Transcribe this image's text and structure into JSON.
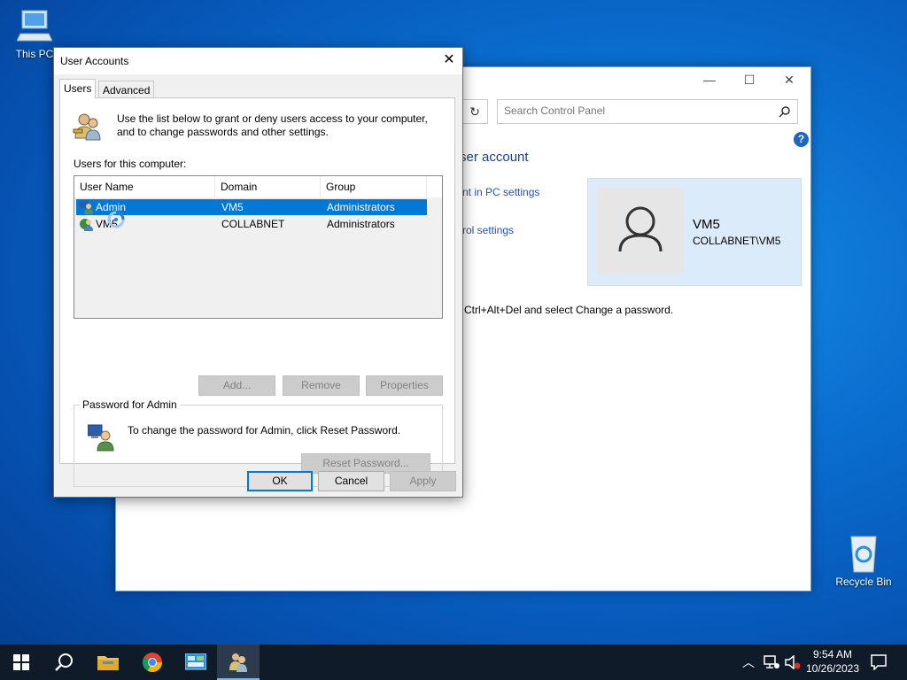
{
  "desktop": {
    "this_pc_label": "This PC",
    "recycle_bin_label": "Recycle Bin"
  },
  "control_panel": {
    "search_placeholder": "Search Control Panel",
    "heading_fragment": "ser account",
    "link_pc_settings_fragment": "nt in PC settings",
    "link_control_settings_fragment": "rol settings",
    "account_name": "VM5",
    "account_domain": "COLLABNET\\VM5",
    "ctrl_alt_del_text": "Ctrl+Alt+Del and select Change a password.",
    "help_glyph": "?"
  },
  "dialog": {
    "title": "User Accounts",
    "tabs": [
      {
        "label": "Users",
        "active": true
      },
      {
        "label": "Advanced",
        "active": false
      }
    ],
    "intro": "Use the list below to grant or deny users access to your computer, and to change passwords and other settings.",
    "users_label": "Users for this computer:",
    "columns": [
      "User Name",
      "Domain",
      "Group"
    ],
    "rows": [
      {
        "name": "Admin",
        "domain": "VM5",
        "group": "Administrators",
        "selected": true
      },
      {
        "name": "VM5",
        "domain": "COLLABNET",
        "group": "Administrators",
        "selected": false
      }
    ],
    "buttons": {
      "add": "Add...",
      "remove": "Remove",
      "properties": "Properties",
      "reset_password": "Reset Password...",
      "ok": "OK",
      "cancel": "Cancel",
      "apply": "Apply"
    },
    "password_group_label": "Password for Admin",
    "password_text": "To change the password for Admin, click Reset Password."
  },
  "taskbar": {
    "time": "9:54 AM",
    "date": "10/26/2023",
    "accent": "#76b9ed"
  }
}
